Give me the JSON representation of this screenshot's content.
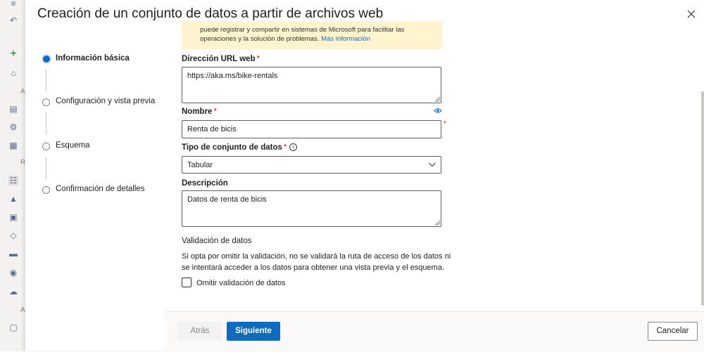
{
  "rail": {
    "icons": [
      "menu-icon",
      "undo-icon",
      "add-icon",
      "home-icon",
      "notebook-icon",
      "automl-icon",
      "designer-icon",
      "datasets-icon",
      "experiments-icon",
      "pipelines-icon",
      "models-icon",
      "endpoints-icon",
      "compute-icon",
      "datastores-icon",
      "labeling-icon"
    ],
    "labels": [
      "A",
      "R",
      "A"
    ]
  },
  "dialog": {
    "title": "Creación de un conjunto de datos a partir de archivos web"
  },
  "steps": [
    {
      "label": "Información básica",
      "active": true
    },
    {
      "label": "Configuración y vista previa",
      "active": false
    },
    {
      "label": "Esquema",
      "active": false
    },
    {
      "label": "Confirmación de detalles",
      "active": false
    }
  ],
  "notice": {
    "line1": "puede registrar y compartir en sistemas de Microsoft para facilitar las",
    "line2": "operaciones y la solución de problemas.",
    "link": "Más información"
  },
  "form": {
    "url": {
      "label": "Dirección URL web",
      "required_mark": "*",
      "value": "https://aka.ms/bike-rentals"
    },
    "name": {
      "label": "Nombre",
      "required_mark": "*",
      "value": "Renta de bicis"
    },
    "type": {
      "label": "Tipo de conjunto de datos",
      "required_mark": "*",
      "info_glyph": "i",
      "value": "Tabular"
    },
    "description": {
      "label": "Descripción",
      "value": "Datos de renta de bicis"
    },
    "validation": {
      "title": "Validación de datos",
      "text": "Si opta por omitir la validación, no se validará la ruta de acceso de los datos ni se intentará acceder a los datos para obtener una vista previa y el esquema.",
      "checkbox_label": "Omitir validación de datos",
      "checked": false
    }
  },
  "footer": {
    "back_label": "Atrás",
    "next_label": "Siguiente",
    "cancel_label": "Cancelar"
  },
  "colors": {
    "accent": "#0f6cbd",
    "notice_bg": "#fff4ce",
    "required": "#a4262c"
  }
}
